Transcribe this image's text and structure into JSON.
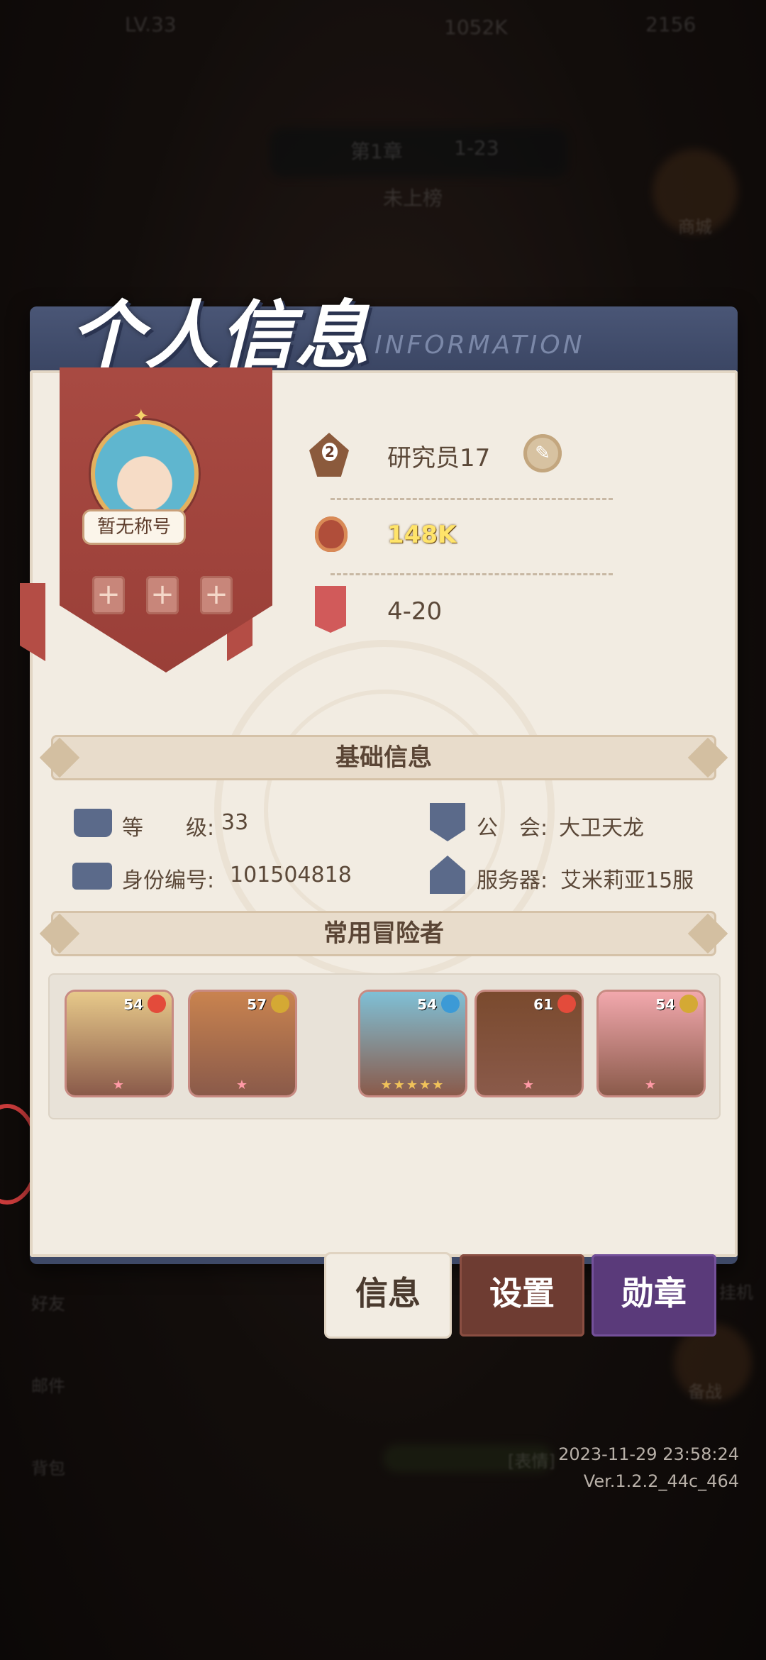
{
  "background": {
    "top_level": "LV.33",
    "top_power": "1052K",
    "top_currency": "2156",
    "chapter": "第1章",
    "chapter_stage": "1-23",
    "rank_status": "未上榜",
    "shop_label": "商城",
    "left_labels": [
      "好友",
      "邮件",
      "背包"
    ],
    "right_labels": [
      "挂机",
      "备战"
    ],
    "chat_hint": "[表情]"
  },
  "panel": {
    "title": "个人信息",
    "subtitle": "INFORMATION"
  },
  "profile": {
    "title_badge": "暂无称号",
    "rank_level": "2",
    "player_name": "研究员17",
    "power": "148K",
    "stage": "4-20",
    "slot_symbol": "+"
  },
  "sections": {
    "basic": "基础信息",
    "adventurers": "常用冒险者"
  },
  "basic_info": {
    "level_label": "等　　级:",
    "level_value": "33",
    "guild_label": "公　会:",
    "guild_value": "大卫天龙",
    "id_label": "身份编号:",
    "id_value": "101504818",
    "server_label": "服务器:",
    "server_value": "艾米莉亚15服"
  },
  "adventurers": [
    {
      "level": "54",
      "element": "fire",
      "element_color": "#e34b3b",
      "stars": "★",
      "bg": "#e7c98a"
    },
    {
      "level": "57",
      "element": "earth",
      "element_color": "#d4a934",
      "stars": "★",
      "bg": "#c9834f"
    },
    {
      "level": "54",
      "element": "water",
      "element_color": "#3c9ad6",
      "stars": "★★★★★",
      "bg": "#7fc0d6"
    },
    {
      "level": "61",
      "element": "fire",
      "element_color": "#e34b3b",
      "stars": "★",
      "bg": "#7a4a2e"
    },
    {
      "level": "54",
      "element": "earth",
      "element_color": "#d4a934",
      "stars": "★",
      "bg": "#f2a8ad"
    }
  ],
  "tabs": {
    "info": "信息",
    "settings": "设置",
    "medal": "勋章"
  },
  "footer": {
    "timestamp": "2023-11-29 23:58:24",
    "version": "Ver.1.2.2_44c_464"
  }
}
